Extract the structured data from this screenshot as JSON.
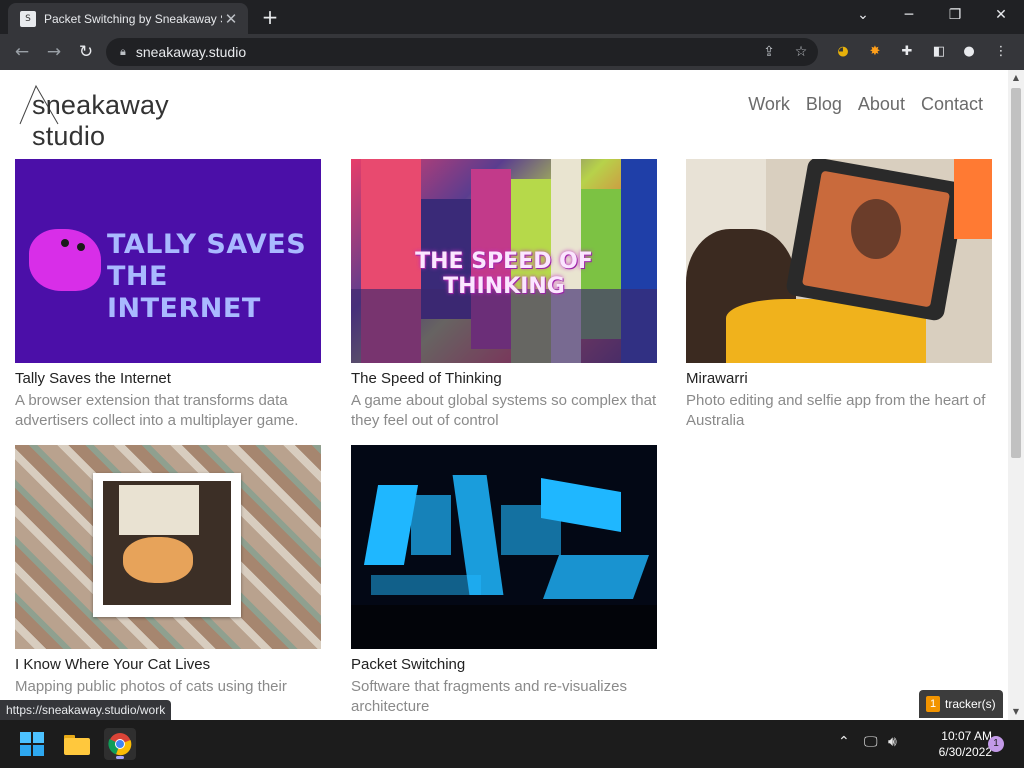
{
  "browser": {
    "tab_title": "Packet Switching by Sneakaway S",
    "url": "sneakaway.studio",
    "status_url": "https://sneakaway.studio/work",
    "tracker_count": "1",
    "tracker_label": "tracker(s)"
  },
  "site": {
    "logo_text": "sneakaway studio",
    "nav": [
      "Work",
      "Blog",
      "About",
      "Contact"
    ]
  },
  "projects": [
    {
      "title": "Tally Saves the Internet",
      "description": "A browser extension that transforms data advertisers collect into a multiplayer game.",
      "thumb_text": [
        "TALLY SAVES",
        "THE INTERNET"
      ]
    },
    {
      "title": "The Speed of Thinking",
      "description": "A game about global systems so complex that they feel out of control",
      "thumb_text": [
        "THE SPEED OF THINKING"
      ]
    },
    {
      "title": "Mirawarri",
      "description": "Photo editing and selfie app from the heart of Australia",
      "thumb_text": []
    },
    {
      "title": "I Know Where Your Cat Lives",
      "description": "Mapping public photos of cats using their metadata",
      "thumb_text": []
    },
    {
      "title": "Packet Switching",
      "description": "Software that fragments and re-visualizes architecture",
      "thumb_text": []
    }
  ],
  "taskbar": {
    "time": "10:07 AM",
    "date": "6/30/2022",
    "notifications": "1"
  },
  "colors": {
    "tally_bg": "#4b0fa8",
    "packet_blue": "#1fb7ff",
    "chrome_dark": "#202124"
  }
}
